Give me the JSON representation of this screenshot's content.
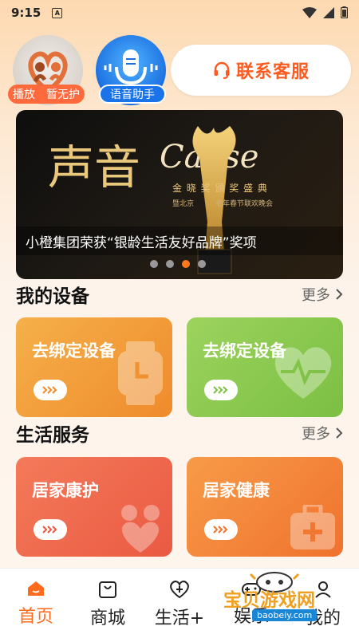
{
  "status": {
    "time": "9:15",
    "sim": "A"
  },
  "top": {
    "play_label": "播放　暂无护",
    "voice_label": "语音助手",
    "service_label": "联系客服"
  },
  "banner": {
    "caption": "小橙集团荣获“银龄生活友好品牌”奖项",
    "overlay_big": "声音",
    "overlay_script": "Cause",
    "overlay_ceremony": "金 晓 奖 颁 奖 盛 典",
    "overlay_sub": "暨北京　　　老年春节联欢晚会",
    "dots": 4,
    "active_dot": 2
  },
  "devices": {
    "title": "我的设备",
    "more": "更多",
    "cards": [
      {
        "label": "去绑定设备",
        "color": "#f3a03a"
      },
      {
        "label": "去绑定设备",
        "color": "#8ccb52"
      }
    ]
  },
  "services": {
    "title": "生活服务",
    "more": "更多",
    "cards": [
      {
        "label": "居家康护",
        "color": "#f06a4a"
      },
      {
        "label": "居家健康",
        "color": "#f58a3c"
      }
    ]
  },
  "tabs": [
    {
      "label": "首页",
      "icon": "home-icon",
      "active": true
    },
    {
      "label": "商城",
      "icon": "shopping-bag-icon",
      "active": false
    },
    {
      "label": "生活+",
      "icon": "heart-plus-icon",
      "active": false
    },
    {
      "label": "娱乐",
      "icon": "gamepad-icon",
      "active": false
    },
    {
      "label": "我的",
      "icon": "person-icon",
      "active": false
    }
  ],
  "watermark": {
    "text": "宝贝游戏网",
    "url": "baobeiy.com"
  },
  "colors": {
    "accent": "#ff6a1c",
    "voice_blue": "#1a73e8"
  }
}
